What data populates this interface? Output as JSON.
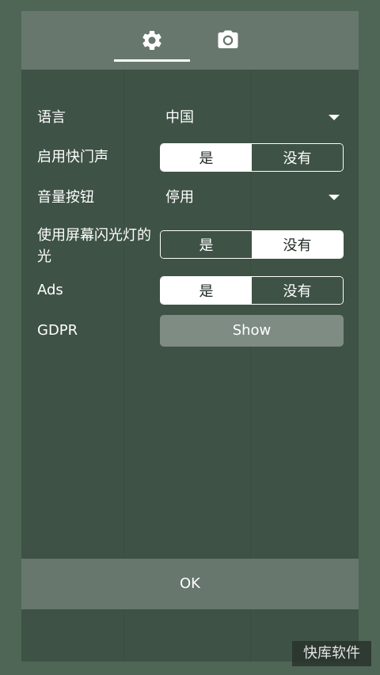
{
  "tabs": [
    {
      "icon": "gear-icon",
      "selected": true
    },
    {
      "icon": "camera-icon",
      "selected": false
    }
  ],
  "settings": {
    "language": {
      "label": "语言",
      "value": "中国"
    },
    "shutter_sound": {
      "label": "启用快门声",
      "yes": "是",
      "no": "没有",
      "selected": "yes"
    },
    "volume_button": {
      "label": "音量按钮",
      "value": "停用"
    },
    "screen_flash": {
      "label": "使用屏幕闪光灯的光",
      "yes": "是",
      "no": "没有",
      "selected": "no"
    },
    "ads": {
      "label": "Ads",
      "yes": "是",
      "no": "没有",
      "selected": "yes"
    },
    "gdpr": {
      "label": "GDPR",
      "button": "Show"
    }
  },
  "ok_label": "OK",
  "watermark": "快库软件",
  "colors": {
    "background": "#4f6657",
    "dialog": "#3e5246",
    "bar": "#67776d",
    "button": "#7f8c84",
    "accent": "#ffffff"
  }
}
